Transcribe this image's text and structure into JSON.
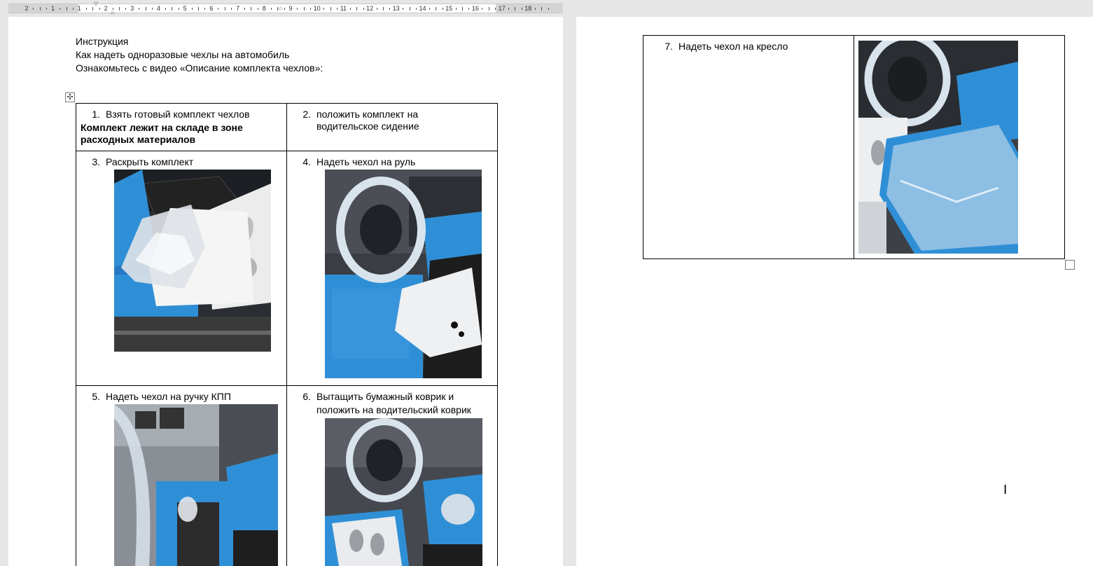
{
  "ruler": {
    "numbers": [
      "2",
      "1",
      "1",
      "2",
      "3",
      "4",
      "5",
      "6",
      "7",
      "8",
      "9",
      "10",
      "11",
      "12",
      "13",
      "14",
      "15",
      "16",
      "17",
      "18"
    ]
  },
  "doc": {
    "title": "Инструкция",
    "subtitle": "Как надеть одноразовые чехлы на автомобиль",
    "intro": "Ознакомьтесь с видео «Описание комплекта чехлов»:"
  },
  "steps": [
    {
      "num": "1.",
      "text": "Взять готовый комплект чехлов",
      "note_line1": "Комплект лежит на складе в зоне",
      "note_line2": "расходных материалов"
    },
    {
      "num": "2.",
      "line1": "положить комплект на",
      "line2": "водительское сидение"
    },
    {
      "num": "3.",
      "text": "Раскрыть комплект"
    },
    {
      "num": "4.",
      "text": "Надеть чехол на руль"
    },
    {
      "num": "5.",
      "text": "Надеть чехол на ручку КПП"
    },
    {
      "num": "6.",
      "line1": "Вытащить бумажный коврик и",
      "line2": "положить на водительский коврик"
    },
    {
      "num": "7.",
      "text": "Надеть чехол на кресло"
    }
  ],
  "icons": {
    "table_move": "move-cross-icon",
    "table_resize": "table-resize-icon",
    "cursor": "text-cursor-icon"
  },
  "colors": {
    "seat_blue": "#2f8fd6",
    "dark": "#1b1b1b",
    "paper": "#f2f2f2"
  }
}
